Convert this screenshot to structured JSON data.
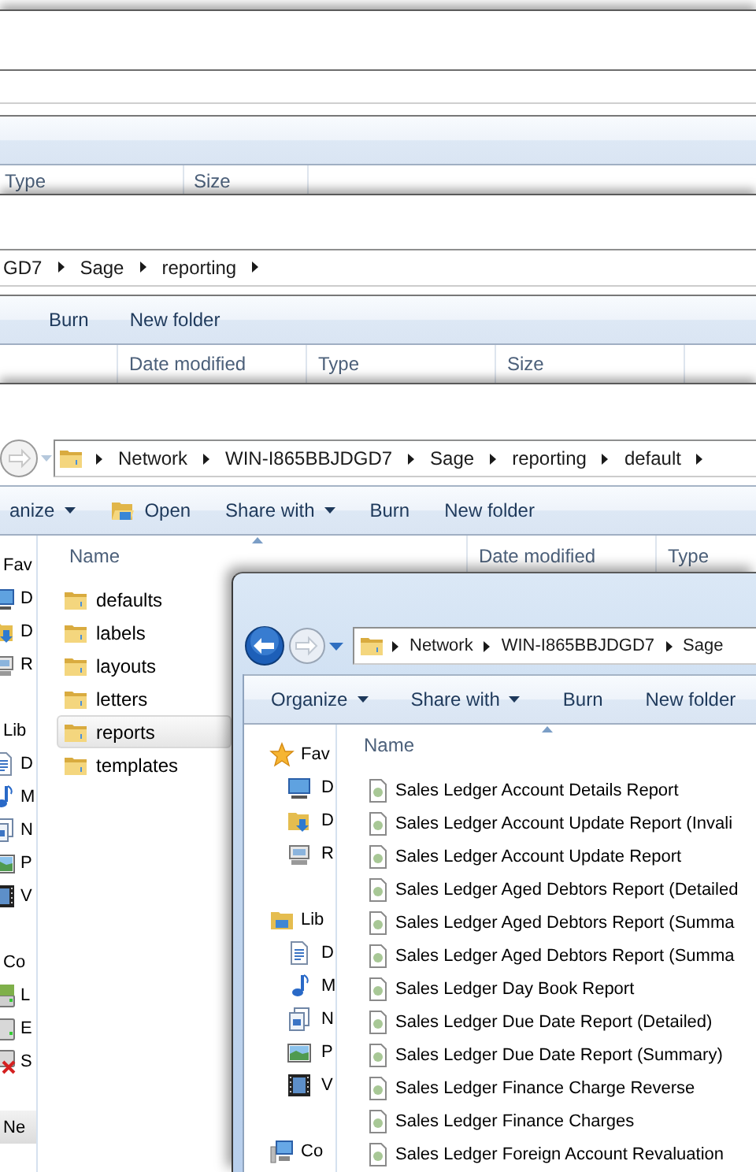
{
  "back_window_1": {
    "columns": [
      "Type",
      "Size"
    ]
  },
  "back_window_2": {
    "breadcrumb": [
      "GD7",
      "Sage",
      "reporting"
    ],
    "trailing_arrow": true,
    "toolbar": [
      {
        "label": "Burn",
        "dropdown": false,
        "kind": "plain"
      },
      {
        "label": "New folder",
        "dropdown": false,
        "kind": "plain"
      }
    ],
    "columns": [
      "Date modified",
      "Type",
      "Size"
    ]
  },
  "explorer_window": {
    "breadcrumb": [
      "Network",
      "WIN-I865BBJDGD7",
      "Sage",
      "reporting",
      "default"
    ],
    "trailing_arrow": true,
    "toolbar": [
      {
        "label": "anize",
        "dropdown": true,
        "kind": "plain"
      },
      {
        "label": "Open",
        "dropdown": false,
        "kind": "icon"
      },
      {
        "label": "Share with",
        "dropdown": true,
        "kind": "plain"
      },
      {
        "label": "Burn",
        "dropdown": false,
        "kind": "plain"
      },
      {
        "label": "New folder",
        "dropdown": false,
        "kind": "plain"
      }
    ],
    "nav_pane": [
      {
        "label": "Fav",
        "selected": false,
        "items": [
          "D",
          "D",
          "R"
        ]
      },
      {
        "label": "Lib",
        "selected": false,
        "items": [
          "D",
          "M",
          "N",
          "P",
          "V"
        ]
      },
      {
        "label": "Co",
        "selected": false,
        "items": [
          "L",
          "E",
          "S"
        ]
      },
      {
        "label": "Ne",
        "selected": true
      }
    ],
    "columns": [
      {
        "label": "Name",
        "sorted": true
      },
      {
        "label": "Date modified",
        "sorted": false
      },
      {
        "label": "Type",
        "sorted": false
      }
    ],
    "files": [
      {
        "name": "defaults",
        "selected": false
      },
      {
        "name": "labels",
        "selected": false
      },
      {
        "name": "layouts",
        "selected": false
      },
      {
        "name": "letters",
        "selected": false
      },
      {
        "name": "reports",
        "selected": true
      },
      {
        "name": "templates",
        "selected": false
      }
    ]
  },
  "front_window": {
    "breadcrumb": [
      "Network",
      "WIN-I865BBJDGD7",
      "Sage"
    ],
    "trailing_arrow": false,
    "toolbar": [
      {
        "label": "Organize",
        "dropdown": true,
        "kind": "plain"
      },
      {
        "label": "Share with",
        "dropdown": true,
        "kind": "plain"
      },
      {
        "label": "Burn",
        "dropdown": false,
        "kind": "plain"
      },
      {
        "label": "New folder",
        "dropdown": false,
        "kind": "plain"
      }
    ],
    "nav_pane": [
      {
        "label": "Fav",
        "selected": false,
        "items": [
          "D",
          "D",
          "R"
        ]
      },
      {
        "label": "Lib",
        "selected": false,
        "items": [
          "D",
          "M",
          "N",
          "P",
          "V"
        ]
      },
      {
        "label": "Co",
        "selected": false
      }
    ],
    "columns": [
      {
        "label": "Name",
        "sorted": true
      }
    ],
    "files": [
      {
        "name": "Sales Ledger Account Details Report",
        "selected": false
      },
      {
        "name": "Sales Ledger Account Update Report (Invali",
        "selected": false
      },
      {
        "name": "Sales Ledger Account Update Report",
        "selected": false
      },
      {
        "name": "Sales Ledger Aged Debtors Report (Detailed",
        "selected": false
      },
      {
        "name": "Sales Ledger Aged Debtors Report (Summa",
        "selected": false
      },
      {
        "name": "Sales Ledger Aged Debtors Report (Summa",
        "selected": false
      },
      {
        "name": "Sales Ledger Day Book Report",
        "selected": false
      },
      {
        "name": "Sales Ledger Due Date Report (Detailed)",
        "selected": false
      },
      {
        "name": "Sales Ledger Due Date Report (Summary)",
        "selected": false
      },
      {
        "name": "Sales Ledger Finance Charge Reverse",
        "selected": false
      },
      {
        "name": "Sales Ledger Finance Charges",
        "selected": false
      },
      {
        "name": "Sales Ledger Foreign Account Revaluation",
        "selected": false
      }
    ]
  }
}
